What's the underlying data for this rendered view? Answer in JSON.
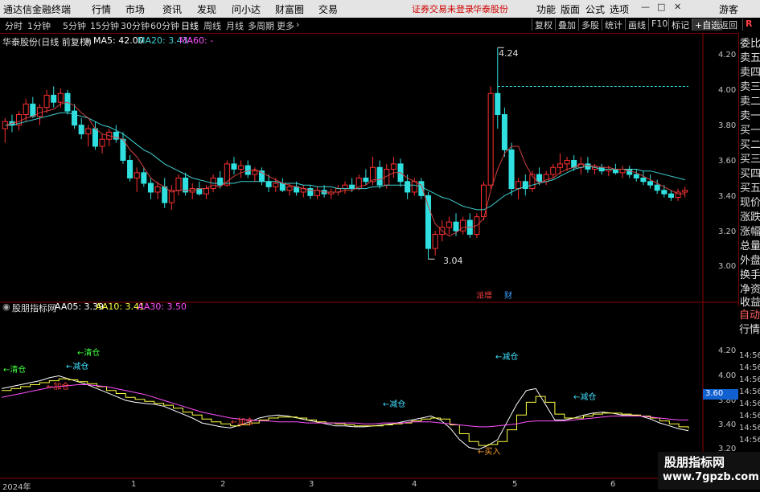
{
  "app": {
    "title": "通达信金融终端",
    "menus": [
      "行情",
      "市场",
      "资讯",
      "发现",
      "问小达",
      "财富圈",
      "交易"
    ],
    "alert": "证券交易未登录",
    "stock_tag": "华泰股份",
    "right_menus": [
      "功能",
      "版面",
      "公式",
      "选项"
    ],
    "guest": "游客"
  },
  "toolbar": {
    "periods": [
      "分时",
      "1分钟",
      "5分钟",
      "15分钟",
      "30分钟",
      "60分钟",
      "日线",
      "周线",
      "月线",
      "多周期",
      "更多"
    ],
    "active_period": "日线",
    "buttons": [
      "复权",
      "叠加",
      "多股",
      "统计",
      "画线",
      "F10",
      "标记",
      "+自选",
      "返回"
    ]
  },
  "main_chart": {
    "title": "华泰股份(日线 前复权)",
    "ma5_label": "MA5: 42.00",
    "ma20_label": "MA20: 3.43",
    "ma60_label": "MA60: -",
    "high_label": "4.24",
    "low_label": "3.04",
    "events": [
      "派增",
      "财"
    ],
    "colors": {
      "ma5": "#ffffff",
      "ma20": "#3fd0d0",
      "ma60": "#ff50ff",
      "up": "#ff3030",
      "down": "#30e0e0",
      "dash": "#30e0e0"
    }
  },
  "right_panel": {
    "items": [
      "委比",
      "卖五",
      "卖四",
      "卖三",
      "卖二",
      "卖一",
      "买一",
      "买二",
      "买三",
      "买四",
      "买五",
      "现价",
      "涨跌",
      "涨幅",
      "总量",
      "外盘",
      "换手",
      "净资",
      "收益"
    ],
    "items2": [
      "自动",
      "行情"
    ]
  },
  "indicator": {
    "title": "股朋指标网",
    "aa05_label": "AA05: 3.39",
    "aa10_label": "AA10: 3.41",
    "aa30_label": "AA30: 3.50",
    "current_value": "3.60",
    "annotations": [
      "←清仓",
      "←减仓",
      "←清仓",
      "←加仓",
      "←加仓",
      "←减仓",
      "←减仓",
      "←买入",
      "←减仓"
    ]
  },
  "chart_data": [
    {
      "type": "candlestick",
      "title": "华泰股份(日线 前复权)",
      "y_ticks": [
        "4.20",
        "4.00",
        "3.80",
        "3.60",
        "3.40",
        "3.20",
        "3.00"
      ],
      "ylim": [
        2.95,
        4.28
      ],
      "annotations": {
        "high": 4.24,
        "low": 3.04
      },
      "candles": [
        [
          3.78,
          3.84,
          3.7,
          3.82
        ],
        [
          3.82,
          3.86,
          3.76,
          3.8
        ],
        [
          3.8,
          3.88,
          3.77,
          3.86
        ],
        [
          3.86,
          3.95,
          3.82,
          3.92
        ],
        [
          3.92,
          3.96,
          3.84,
          3.85
        ],
        [
          3.85,
          3.92,
          3.8,
          3.9
        ],
        [
          3.9,
          4.0,
          3.87,
          3.97
        ],
        [
          3.97,
          4.02,
          3.9,
          3.93
        ],
        [
          3.93,
          4.01,
          3.9,
          3.98
        ],
        [
          3.98,
          4.0,
          3.86,
          3.88
        ],
        [
          3.88,
          3.92,
          3.78,
          3.8
        ],
        [
          3.8,
          3.84,
          3.72,
          3.75
        ],
        [
          3.75,
          3.8,
          3.68,
          3.78
        ],
        [
          3.78,
          3.82,
          3.66,
          3.68
        ],
        [
          3.68,
          3.75,
          3.64,
          3.72
        ],
        [
          3.72,
          3.78,
          3.68,
          3.76
        ],
        [
          3.76,
          3.8,
          3.7,
          3.72
        ],
        [
          3.72,
          3.76,
          3.58,
          3.6
        ],
        [
          3.6,
          3.63,
          3.48,
          3.5
        ],
        [
          3.5,
          3.56,
          3.42,
          3.53
        ],
        [
          3.53,
          3.56,
          3.45,
          3.47
        ],
        [
          3.47,
          3.5,
          3.38,
          3.42
        ],
        [
          3.42,
          3.48,
          3.38,
          3.45
        ],
        [
          3.45,
          3.5,
          3.33,
          3.36
        ],
        [
          3.36,
          3.46,
          3.32,
          3.43
        ],
        [
          3.43,
          3.52,
          3.4,
          3.5
        ],
        [
          3.5,
          3.53,
          3.4,
          3.42
        ],
        [
          3.42,
          3.47,
          3.38,
          3.44
        ],
        [
          3.44,
          3.48,
          3.4,
          3.41
        ],
        [
          3.41,
          3.46,
          3.38,
          3.44
        ],
        [
          3.44,
          3.52,
          3.42,
          3.5
        ],
        [
          3.5,
          3.54,
          3.44,
          3.46
        ],
        [
          3.46,
          3.6,
          3.45,
          3.58
        ],
        [
          3.58,
          3.62,
          3.52,
          3.55
        ],
        [
          3.55,
          3.6,
          3.5,
          3.57
        ],
        [
          3.57,
          3.6,
          3.5,
          3.52
        ],
        [
          3.52,
          3.56,
          3.48,
          3.54
        ],
        [
          3.54,
          3.56,
          3.46,
          3.48
        ],
        [
          3.48,
          3.52,
          3.42,
          3.45
        ],
        [
          3.45,
          3.5,
          3.42,
          3.47
        ],
        [
          3.47,
          3.5,
          3.42,
          3.43
        ],
        [
          3.43,
          3.47,
          3.4,
          3.45
        ],
        [
          3.45,
          3.48,
          3.4,
          3.42
        ],
        [
          3.42,
          3.46,
          3.39,
          3.44
        ],
        [
          3.44,
          3.46,
          3.38,
          3.4
        ],
        [
          3.4,
          3.45,
          3.38,
          3.43
        ],
        [
          3.43,
          3.46,
          3.39,
          3.41
        ],
        [
          3.41,
          3.44,
          3.38,
          3.42
        ],
        [
          3.42,
          3.46,
          3.4,
          3.44
        ],
        [
          3.44,
          3.48,
          3.41,
          3.46
        ],
        [
          3.46,
          3.5,
          3.42,
          3.44
        ],
        [
          3.44,
          3.52,
          3.43,
          3.5
        ],
        [
          3.5,
          3.55,
          3.46,
          3.48
        ],
        [
          3.48,
          3.62,
          3.46,
          3.56
        ],
        [
          3.56,
          3.6,
          3.44,
          3.46
        ],
        [
          3.46,
          3.58,
          3.44,
          3.55
        ],
        [
          3.55,
          3.62,
          3.5,
          3.58
        ],
        [
          3.58,
          3.61,
          3.45,
          3.48
        ],
        [
          3.48,
          3.52,
          3.38,
          3.42
        ],
        [
          3.42,
          3.5,
          3.4,
          3.48
        ],
        [
          3.48,
          3.5,
          3.38,
          3.4
        ],
        [
          3.4,
          3.42,
          3.04,
          3.1
        ],
        [
          3.1,
          3.2,
          3.06,
          3.18
        ],
        [
          3.18,
          3.26,
          3.14,
          3.22
        ],
        [
          3.22,
          3.28,
          3.18,
          3.25
        ],
        [
          3.25,
          3.3,
          3.17,
          3.2
        ],
        [
          3.2,
          3.28,
          3.18,
          3.26
        ],
        [
          3.26,
          3.3,
          3.16,
          3.18
        ],
        [
          3.18,
          3.3,
          3.16,
          3.28
        ],
        [
          3.28,
          3.48,
          3.26,
          3.46
        ],
        [
          3.46,
          4.02,
          3.44,
          3.98
        ],
        [
          3.98,
          4.24,
          3.78,
          3.86
        ],
        [
          3.86,
          3.9,
          3.62,
          3.66
        ],
        [
          3.66,
          3.7,
          3.4,
          3.44
        ],
        [
          3.44,
          3.5,
          3.38,
          3.48
        ],
        [
          3.48,
          3.52,
          3.4,
          3.44
        ],
        [
          3.44,
          3.54,
          3.42,
          3.52
        ],
        [
          3.52,
          3.56,
          3.46,
          3.48
        ],
        [
          3.48,
          3.54,
          3.46,
          3.52
        ],
        [
          3.52,
          3.58,
          3.5,
          3.56
        ],
        [
          3.56,
          3.64,
          3.52,
          3.58
        ],
        [
          3.58,
          3.62,
          3.54,
          3.6
        ],
        [
          3.6,
          3.63,
          3.54,
          3.56
        ],
        [
          3.56,
          3.62,
          3.52,
          3.58
        ],
        [
          3.58,
          3.62,
          3.53,
          3.55
        ],
        [
          3.55,
          3.58,
          3.52,
          3.56
        ],
        [
          3.56,
          3.58,
          3.52,
          3.54
        ],
        [
          3.54,
          3.57,
          3.51,
          3.55
        ],
        [
          3.55,
          3.58,
          3.52,
          3.53
        ],
        [
          3.53,
          3.57,
          3.5,
          3.55
        ],
        [
          3.55,
          3.57,
          3.5,
          3.52
        ],
        [
          3.52,
          3.55,
          3.48,
          3.5
        ],
        [
          3.5,
          3.54,
          3.46,
          3.48
        ],
        [
          3.48,
          3.52,
          3.44,
          3.46
        ],
        [
          3.46,
          3.49,
          3.41,
          3.43
        ],
        [
          3.43,
          3.46,
          3.39,
          3.41
        ],
        [
          3.41,
          3.43,
          3.37,
          3.39
        ],
        [
          3.39,
          3.44,
          3.37,
          3.42
        ],
        [
          3.42,
          3.45,
          3.39,
          3.43
        ]
      ],
      "ma5": [
        3.8,
        3.81,
        3.82,
        3.84,
        3.85,
        3.87,
        3.88,
        3.89,
        3.92,
        3.93,
        3.91,
        3.87,
        3.84,
        3.78,
        3.75,
        3.74,
        3.73,
        3.72,
        3.66,
        3.62,
        3.56,
        3.5,
        3.47,
        3.45,
        3.42,
        3.43,
        3.43,
        3.43,
        3.44,
        3.44,
        3.46,
        3.45,
        3.48,
        3.51,
        3.53,
        3.54,
        3.55,
        3.53,
        3.51,
        3.49,
        3.47,
        3.46,
        3.45,
        3.44,
        3.43,
        3.43,
        3.42,
        3.42,
        3.42,
        3.43,
        3.43,
        3.45,
        3.46,
        3.49,
        3.49,
        3.51,
        3.53,
        3.53,
        3.5,
        3.48,
        3.46,
        3.34,
        3.24,
        3.2,
        3.17,
        3.19,
        3.22,
        3.22,
        3.23,
        3.27,
        3.43,
        3.55,
        3.64,
        3.68,
        3.68,
        3.58,
        3.51,
        3.47,
        3.49,
        3.5,
        3.53,
        3.55,
        3.56,
        3.58,
        3.57,
        3.57,
        3.56,
        3.56,
        3.55,
        3.55,
        3.54,
        3.53,
        3.51,
        3.49,
        3.47,
        3.45,
        3.43,
        3.41,
        3.41
      ],
      "ma20": [
        3.8,
        3.8,
        3.81,
        3.82,
        3.83,
        3.84,
        3.85,
        3.86,
        3.87,
        3.87,
        3.86,
        3.85,
        3.84,
        3.82,
        3.8,
        3.79,
        3.77,
        3.75,
        3.72,
        3.69,
        3.66,
        3.64,
        3.61,
        3.58,
        3.56,
        3.54,
        3.52,
        3.5,
        3.49,
        3.48,
        3.47,
        3.47,
        3.47,
        3.47,
        3.48,
        3.48,
        3.48,
        3.48,
        3.48,
        3.48,
        3.47,
        3.47,
        3.47,
        3.46,
        3.46,
        3.45,
        3.45,
        3.45,
        3.44,
        3.44,
        3.44,
        3.44,
        3.44,
        3.45,
        3.45,
        3.46,
        3.46,
        3.46,
        3.46,
        3.46,
        3.45,
        3.43,
        3.41,
        3.39,
        3.38,
        3.36,
        3.34,
        3.33,
        3.32,
        3.32,
        3.34,
        3.37,
        3.4,
        3.42,
        3.44,
        3.45,
        3.46,
        3.47,
        3.48,
        3.49,
        3.51,
        3.53,
        3.55,
        3.56,
        3.57,
        3.56,
        3.55,
        3.55,
        3.55,
        3.55,
        3.55,
        3.55,
        3.54,
        3.54,
        3.53,
        3.52,
        3.51,
        3.5,
        3.49
      ]
    },
    {
      "type": "line",
      "title": "股朋指标网",
      "y_ticks": [
        "4.20",
        "4.00",
        "3.80",
        "3.60",
        "3.40",
        "3.20"
      ],
      "ylim": [
        3.18,
        4.32
      ],
      "time_ticks": [
        "14:56",
        "14:56",
        "14:56",
        "14:56",
        "14:56",
        "14:56",
        "14:56",
        "14:56",
        "14:56",
        "14:56",
        "14:56"
      ],
      "x_labels": [
        "2024年",
        "1",
        "2",
        "3",
        "4",
        "5",
        "6"
      ],
      "series": [
        {
          "name": "AA05",
          "values": [
            3.82,
            3.84,
            3.86,
            3.88,
            3.9,
            3.93,
            3.95,
            3.92,
            3.89,
            3.86,
            3.82,
            3.78,
            3.74,
            3.7,
            3.68,
            3.67,
            3.66,
            3.64,
            3.6,
            3.56,
            3.52,
            3.47,
            3.45,
            3.43,
            3.42,
            3.45,
            3.48,
            3.52,
            3.54,
            3.55,
            3.54,
            3.52,
            3.5,
            3.48,
            3.46,
            3.44,
            3.44,
            3.43,
            3.43,
            3.44,
            3.45,
            3.46,
            3.48,
            3.5,
            3.52,
            3.54,
            3.5,
            3.42,
            3.3,
            3.22,
            3.2,
            3.24,
            3.3,
            3.48,
            3.66,
            3.8,
            3.82,
            3.66,
            3.5,
            3.5,
            3.52,
            3.55,
            3.57,
            3.58,
            3.57,
            3.55,
            3.55,
            3.54,
            3.51,
            3.47,
            3.44,
            3.41,
            3.39
          ]
        },
        {
          "name": "AA10",
          "values": [
            3.8,
            3.82,
            3.84,
            3.86,
            3.88,
            3.9,
            3.92,
            3.91,
            3.89,
            3.87,
            3.84,
            3.8,
            3.77,
            3.73,
            3.71,
            3.69,
            3.67,
            3.65,
            3.62,
            3.58,
            3.55,
            3.51,
            3.48,
            3.46,
            3.44,
            3.45,
            3.47,
            3.5,
            3.52,
            3.53,
            3.53,
            3.52,
            3.5,
            3.48,
            3.47,
            3.46,
            3.45,
            3.44,
            3.44,
            3.44,
            3.45,
            3.46,
            3.47,
            3.49,
            3.51,
            3.52,
            3.51,
            3.45,
            3.36,
            3.28,
            3.24,
            3.25,
            3.28,
            3.4,
            3.55,
            3.68,
            3.74,
            3.68,
            3.56,
            3.52,
            3.52,
            3.54,
            3.56,
            3.57,
            3.57,
            3.56,
            3.55,
            3.54,
            3.52,
            3.49,
            3.46,
            3.43,
            3.41
          ]
        },
        {
          "name": "AA30",
          "values": [
            3.73,
            3.75,
            3.77,
            3.79,
            3.81,
            3.83,
            3.84,
            3.85,
            3.86,
            3.86,
            3.85,
            3.84,
            3.82,
            3.8,
            3.78,
            3.76,
            3.73,
            3.7,
            3.67,
            3.64,
            3.61,
            3.58,
            3.56,
            3.54,
            3.52,
            3.51,
            3.5,
            3.49,
            3.49,
            3.48,
            3.48,
            3.48,
            3.47,
            3.47,
            3.47,
            3.47,
            3.47,
            3.47,
            3.46,
            3.46,
            3.47,
            3.47,
            3.47,
            3.48,
            3.48,
            3.48,
            3.47,
            3.46,
            3.45,
            3.44,
            3.43,
            3.43,
            3.44,
            3.45,
            3.46,
            3.48,
            3.49,
            3.49,
            3.49,
            3.49,
            3.5,
            3.51,
            3.52,
            3.53,
            3.54,
            3.54,
            3.54,
            3.54,
            3.53,
            3.52,
            3.51,
            3.5,
            3.5
          ]
        }
      ]
    }
  ]
}
